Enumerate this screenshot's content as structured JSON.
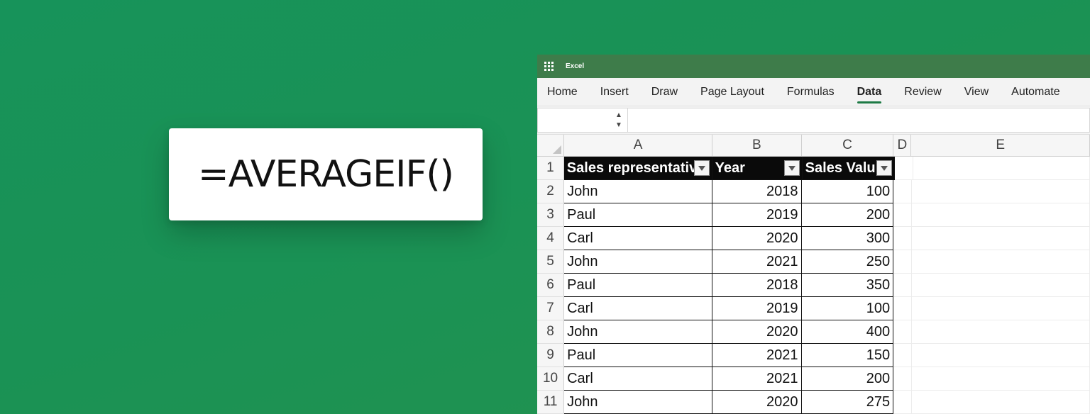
{
  "formula": {
    "text": "=AVERAGEIF()"
  },
  "excel": {
    "app_name": "Excel",
    "ribbon_tabs": [
      "Home",
      "Insert",
      "Draw",
      "Page Layout",
      "Formulas",
      "Data",
      "Review",
      "View",
      "Automate"
    ],
    "active_tab": "Data",
    "name_box_value": "",
    "formula_bar_value": "",
    "column_letters": [
      "A",
      "B",
      "C",
      "D",
      "E"
    ],
    "table": {
      "headers": [
        "Sales representativ",
        "Year",
        "Sales Valu"
      ],
      "rows": [
        [
          "John",
          "2018",
          "100"
        ],
        [
          "Paul",
          "2019",
          "200"
        ],
        [
          "Carl",
          "2020",
          "300"
        ],
        [
          "John",
          "2021",
          "250"
        ],
        [
          "Paul",
          "2018",
          "350"
        ],
        [
          "Carl",
          "2019",
          "100"
        ],
        [
          "John",
          "2020",
          "400"
        ],
        [
          "Paul",
          "2021",
          "150"
        ],
        [
          "Carl",
          "2021",
          "200"
        ],
        [
          "John",
          "2020",
          "275"
        ]
      ]
    },
    "row_numbers": [
      "1",
      "2",
      "3",
      "4",
      "5",
      "6",
      "7",
      "8",
      "9",
      "10",
      "11"
    ],
    "colors": {
      "title_bar": "#3e7c4a",
      "accent": "#1e7a45",
      "background": "#17935a"
    }
  }
}
